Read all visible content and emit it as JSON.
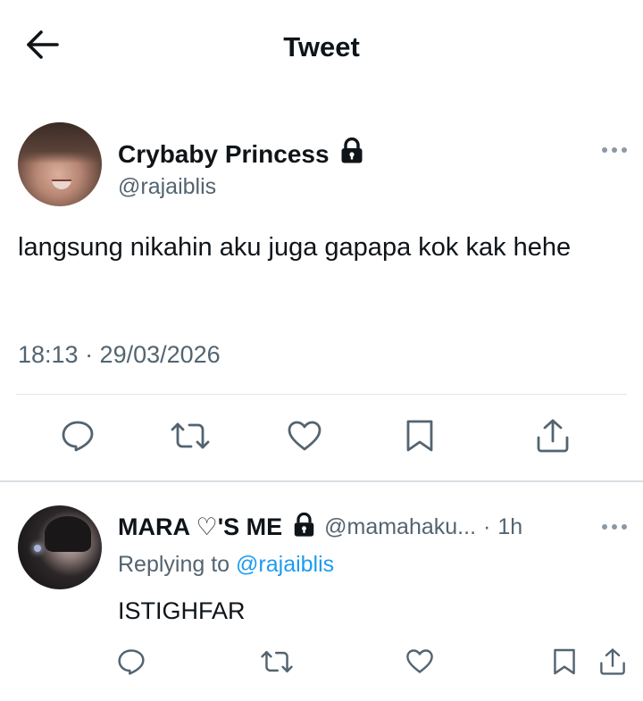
{
  "header": {
    "title": "Tweet",
    "back_icon": "arrow-left-icon"
  },
  "colors": {
    "text_primary": "#0f1419",
    "text_secondary": "#536471",
    "link": "#1d9bf0",
    "divider": "#e1e4e6"
  },
  "main_tweet": {
    "display_name": "Crybaby Princess",
    "protected_icon": "lock-icon",
    "handle": "@rajaiblis",
    "text": "langsung nikahin aku juga gapapa kok kak hehe",
    "timestamp": "18:13 · 29/03/2026",
    "actions": [
      "reply-icon",
      "retweet-icon",
      "like-icon",
      "bookmark-icon",
      "share-icon"
    ]
  },
  "reply_tweet": {
    "display_name": "MARA ♡'S ME",
    "protected_icon": "lock-icon",
    "handle": "@mamahaku...",
    "separator": "·",
    "time": "1h",
    "replying_prefix": "Replying to",
    "replying_handle": "@rajaiblis",
    "text": "ISTIGHFAR",
    "actions": [
      "reply-icon",
      "retweet-icon",
      "like-icon",
      "bookmark-icon",
      "share-icon"
    ]
  }
}
